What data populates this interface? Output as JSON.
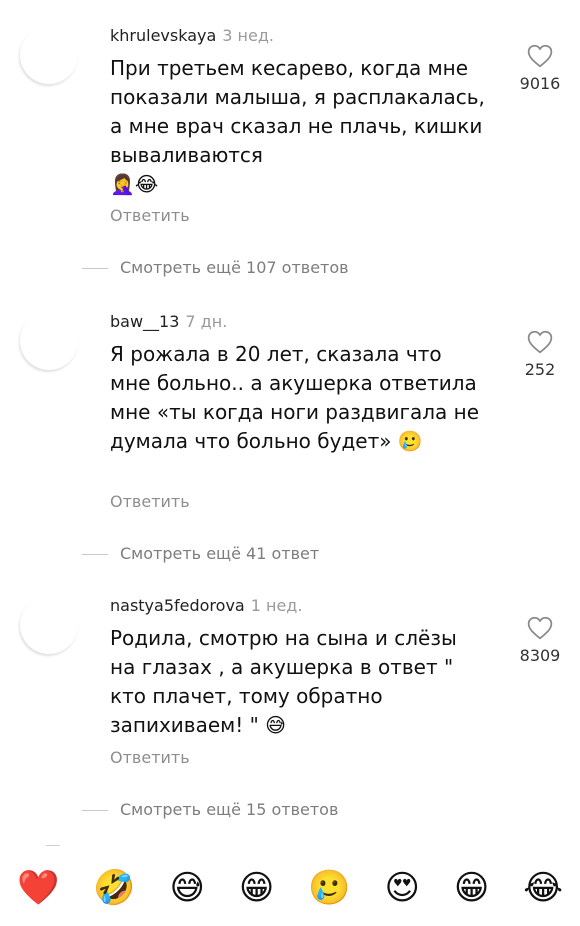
{
  "comments": [
    {
      "username": "khrulevskaya",
      "time": "3 нед.",
      "text": "При третьем кесарево, когда мне показали малыша, я расплакалась, а мне врач сказал не плачь, кишки вываливаются",
      "emoji": "🤦‍♀️😂",
      "likes": "9016",
      "reply_label": "Ответить",
      "more_replies": "Смотреть ещё 107 ответов"
    },
    {
      "username": "baw__13",
      "time": "7 дн.",
      "text": "Я рожала в 20 лет, сказала что мне больно.. а акушерка ответила мне «ты когда ноги раздвигала не думала что больно будет»",
      "emoji": "🥲",
      "likes": "252",
      "reply_label": "Ответить",
      "more_replies": "Смотреть ещё 41 ответ"
    },
    {
      "username": "nastya5fedorova",
      "time": "1 нед.",
      "text": "Родила, смотрю на сына и слёзы на глазах , а акушерка в ответ \" кто плачет, тому обратно запихиваем! \"",
      "emoji": "😅",
      "likes": "8309",
      "reply_label": "Ответить",
      "more_replies": "Смотреть ещё 15 ответов"
    }
  ],
  "emoji_bar": [
    "❤️",
    "🤣",
    "😅",
    "😁",
    "🥲",
    "😍",
    "😁",
    "😂"
  ],
  "colors": {
    "text": "#111111",
    "muted": "#8e8e8e",
    "background": "#ffffff"
  },
  "icons": {
    "like": "heart-outline-icon"
  }
}
